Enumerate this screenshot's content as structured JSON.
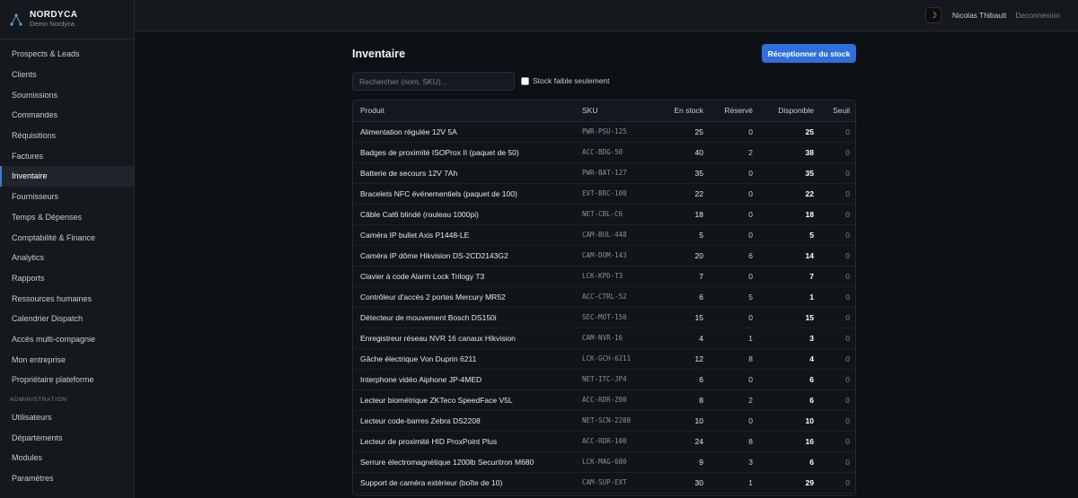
{
  "brand": {
    "name": "NORDYCA",
    "subtitle": "Demo Nordyca"
  },
  "sidebar": {
    "items": [
      {
        "label": "Prospects & Leads"
      },
      {
        "label": "Clients"
      },
      {
        "label": "Soumissions"
      },
      {
        "label": "Commandes"
      },
      {
        "label": "Réquisitions"
      },
      {
        "label": "Factures"
      },
      {
        "label": "Inventaire",
        "active": true
      },
      {
        "label": "Fournisseurs"
      },
      {
        "label": "Temps & Dépenses"
      },
      {
        "label": "Comptabilité & Finance"
      },
      {
        "label": "Analytics"
      },
      {
        "label": "Rapports"
      },
      {
        "label": "Ressources humaines"
      },
      {
        "label": "Calendrier Dispatch"
      },
      {
        "label": "Accès multi-compagnie"
      },
      {
        "label": "Mon entreprise"
      },
      {
        "label": "Propriétaire plateforme"
      }
    ],
    "admin_section": "ADMINISTRATION",
    "admin_items": [
      {
        "label": "Utilisateurs"
      },
      {
        "label": "Départements"
      },
      {
        "label": "Modules"
      },
      {
        "label": "Paramètres"
      }
    ]
  },
  "topbar": {
    "theme_icon": "moon-icon",
    "user": "Nicolas Thibault",
    "logout": "Deconnexion"
  },
  "page": {
    "title": "Inventaire",
    "receive_button": "Réceptionner du stock",
    "search_placeholder": "Rechercher (nom, SKU)...",
    "low_stock_label": "Stock faible seulement",
    "low_stock_checked": false
  },
  "table": {
    "headers": {
      "product": "Produit",
      "sku": "SKU",
      "stock": "En stock",
      "reserved": "Réservé",
      "available": "Disponible",
      "threshold": "Seuil"
    },
    "rows": [
      {
        "product": "Alimentation régulée 12V 5A",
        "sku": "PWR-PSU-125",
        "stock": "25",
        "reserved": "0",
        "available": "25",
        "threshold": "0"
      },
      {
        "product": "Badges de proximité ISOProx II (paquet de 50)",
        "sku": "ACC-BDG-50",
        "stock": "40",
        "reserved": "2",
        "available": "38",
        "threshold": "0"
      },
      {
        "product": "Batterie de secours 12V 7Ah",
        "sku": "PWR-BAT-127",
        "stock": "35",
        "reserved": "0",
        "available": "35",
        "threshold": "0"
      },
      {
        "product": "Bracelets NFC événementiels (paquet de 100)",
        "sku": "EVT-BRC-100",
        "stock": "22",
        "reserved": "0",
        "available": "22",
        "threshold": "0"
      },
      {
        "product": "Câble Cat6 blindé (rouleau 1000pi)",
        "sku": "NET-CBL-C6",
        "stock": "18",
        "reserved": "0",
        "available": "18",
        "threshold": "0"
      },
      {
        "product": "Caméra IP bullet Axis P1448-LE",
        "sku": "CAM-BUL-448",
        "stock": "5",
        "reserved": "0",
        "available": "5",
        "threshold": "0"
      },
      {
        "product": "Caméra IP dôme Hikvision DS-2CD2143G2",
        "sku": "CAM-DOM-143",
        "stock": "20",
        "reserved": "6",
        "available": "14",
        "threshold": "0"
      },
      {
        "product": "Clavier à code Alarm Lock Trilogy T3",
        "sku": "LCK-KPD-T3",
        "stock": "7",
        "reserved": "0",
        "available": "7",
        "threshold": "0"
      },
      {
        "product": "Contrôleur d'accès 2 portes Mercury MR52",
        "sku": "ACC-CTRL-52",
        "stock": "6",
        "reserved": "5",
        "available": "1",
        "threshold": "0"
      },
      {
        "product": "Détecteur de mouvement Bosch DS150i",
        "sku": "SEC-MOT-150",
        "stock": "15",
        "reserved": "0",
        "available": "15",
        "threshold": "0"
      },
      {
        "product": "Enregistreur réseau NVR 16 canaux Hikvision",
        "sku": "CAM-NVR-16",
        "stock": "4",
        "reserved": "1",
        "available": "3",
        "threshold": "0"
      },
      {
        "product": "Gâche électrique Von Duprin 6211",
        "sku": "LCK-GCH-6211",
        "stock": "12",
        "reserved": "8",
        "available": "4",
        "threshold": "0"
      },
      {
        "product": "Interphone vidéo Aiphone JP-4MED",
        "sku": "NET-ITC-JP4",
        "stock": "6",
        "reserved": "0",
        "available": "6",
        "threshold": "0"
      },
      {
        "product": "Lecteur biométrique ZKTeco SpeedFace V5L",
        "sku": "ACC-RDR-Z00",
        "stock": "8",
        "reserved": "2",
        "available": "6",
        "threshold": "0"
      },
      {
        "product": "Lecteur code-barres Zebra DS2208",
        "sku": "NET-SCN-2208",
        "stock": "10",
        "reserved": "0",
        "available": "10",
        "threshold": "0"
      },
      {
        "product": "Lecteur de proximité HID ProxPoint Plus",
        "sku": "ACC-RDR-100",
        "stock": "24",
        "reserved": "8",
        "available": "16",
        "threshold": "0"
      },
      {
        "product": "Serrure électromagnétique 1200lb Securitron M680",
        "sku": "LCK-MAG-680",
        "stock": "9",
        "reserved": "3",
        "available": "6",
        "threshold": "0"
      },
      {
        "product": "Support de caméra extérieur (boîte de 10)",
        "sku": "CAM-SUP-EXT",
        "stock": "30",
        "reserved": "1",
        "available": "29",
        "threshold": "0"
      }
    ]
  }
}
